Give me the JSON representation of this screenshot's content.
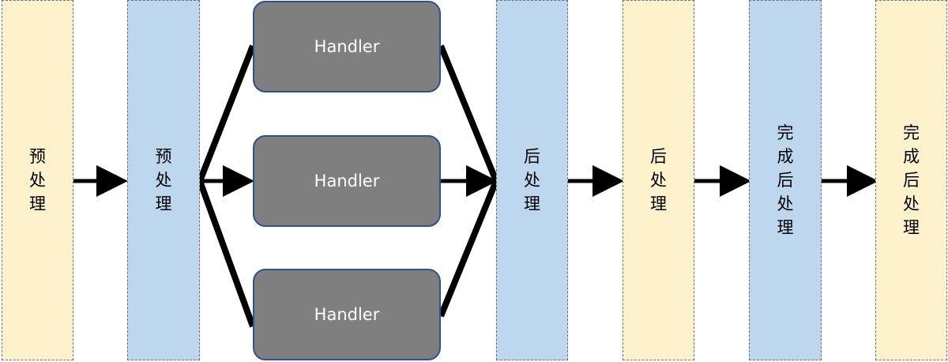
{
  "stages": [
    {
      "id": "pre-1",
      "label": "预处理",
      "color": "#fef2cc"
    },
    {
      "id": "pre-2",
      "label": "预处理",
      "color": "#bdd7ee"
    },
    {
      "id": "post-1",
      "label": "后处理",
      "color": "#bdd7ee"
    },
    {
      "id": "post-2",
      "label": "后处理",
      "color": "#fef2cc"
    },
    {
      "id": "done-1",
      "label": "完成后处理",
      "color": "#bdd7ee"
    },
    {
      "id": "done-2",
      "label": "完成后处理",
      "color": "#fef2cc"
    }
  ],
  "handlers": [
    {
      "label": "Handler"
    },
    {
      "label": "Handler"
    },
    {
      "label": "Handler"
    }
  ],
  "colors": {
    "handler_fill": "#7f7f7f",
    "handler_border": "#2f528f",
    "arrow": "#000000"
  }
}
